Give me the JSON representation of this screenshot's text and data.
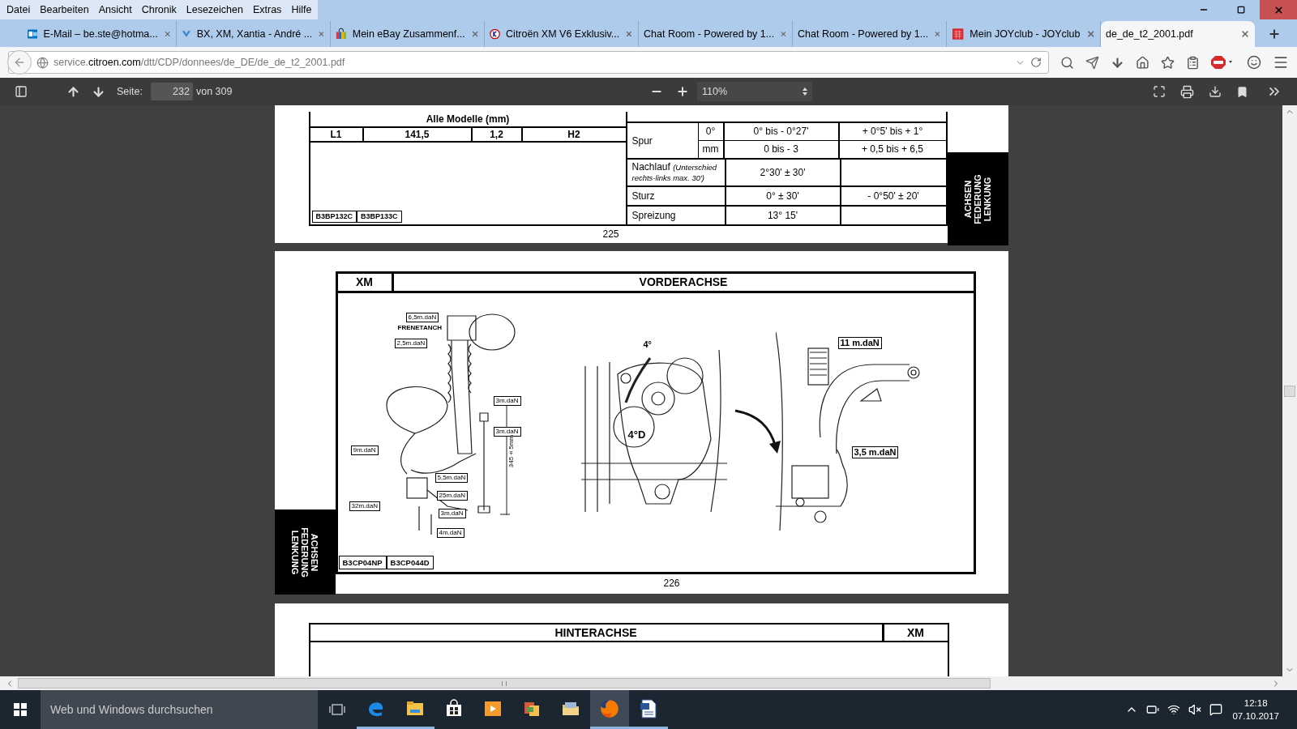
{
  "menu": [
    "Datei",
    "Bearbeiten",
    "Ansicht",
    "Chronik",
    "Lesezeichen",
    "Extras",
    "Hilfe"
  ],
  "tabs": [
    {
      "title": "E-Mail – be.ste@hotma...",
      "kind": "mail",
      "selected": false
    },
    {
      "title": "BX, XM, Xantia - André ...",
      "kind": "chevron",
      "selected": false
    },
    {
      "title": "Mein eBay Zusammenf...",
      "kind": "bag",
      "selected": false
    },
    {
      "title": "Citroën XM V6 Exklusiv...",
      "kind": "circle",
      "selected": false
    },
    {
      "title": "Chat Room - Powered by 1...",
      "kind": "plain",
      "selected": false
    },
    {
      "title": "Chat Room - Powered by 1...",
      "kind": "plain",
      "selected": false
    },
    {
      "title": "Mein JOYclub - JOYclub",
      "kind": "calendar",
      "selected": false
    },
    {
      "title": "de_de_t2_2001.pdf",
      "kind": "plain",
      "selected": true
    }
  ],
  "address": "service.**citroen.com**/dtt/CDP/donnees/de_DE/de_de_t2_2001.pdf",
  "pdf_toolbar": {
    "page_label": "Seite:",
    "page": "232",
    "page_count": "von 309",
    "zoom": "110%"
  },
  "page_225": {
    "left_table": {
      "header": "Alle Modelle (mm)",
      "cells": [
        "L1",
        "141,5",
        "1,2",
        "H2"
      ],
      "refs": [
        "B3BP132C",
        "B3BP133C"
      ]
    },
    "right_table": [
      {
        "label": "Spur",
        "sub_rows": [
          {
            "unit": "0°",
            "values": [
              "0° bis - 0°27'",
              "+ 0°5' bis + 1°"
            ]
          },
          {
            "unit": "mm",
            "values": [
              "0 bis - 3",
              "+ 0,5 bis + 6,5"
            ]
          }
        ]
      },
      {
        "label": "Nachlauf *(Unterschied rechts-links max. 30')*",
        "values": [
          "2°30' ± 30'"
        ]
      },
      {
        "label": "Sturz",
        "values": [
          "0° ± 30'",
          "- 0°50' ± 20'"
        ]
      },
      {
        "label": "Spreizung",
        "values": [
          "13° 15'"
        ]
      }
    ],
    "side_tab": [
      "ACHSEN",
      "FEDERUNG",
      "LENKUNG"
    ],
    "page_number": "225"
  },
  "page_226": {
    "model": "XM",
    "title": "VORDERACHSE",
    "drawings": [
      {
        "kind": "strut",
        "callouts": [
          "6,5m.daN",
          "FRENETANCH",
          "2,5m.daN",
          "3m.daN",
          "3m.daN",
          "9m.daN",
          "5,5m.daN",
          "25m.daN",
          "32m.daN",
          "3m.daN",
          "4m.daN",
          "345±5mm"
        ]
      },
      {
        "kind": "hub",
        "callouts": [
          "4°",
          "4°D"
        ]
      },
      {
        "kind": "wishbone",
        "callouts": [
          "11 m.daN",
          "3,5 m.daN"
        ]
      }
    ],
    "refs": [
      "B3CP04NP",
      "B3CP044D"
    ],
    "side_tab": [
      "ACHSEN",
      "FEDERUNG",
      "LENKUNG"
    ],
    "page_number": "226"
  },
  "page_227": {
    "title": "HINTERACHSE",
    "model": "XM"
  },
  "taskbar": {
    "search_placeholder": "Web und Windows durchsuchen",
    "apps": [
      {
        "kind": "edge",
        "selected": false
      },
      {
        "kind": "explorer",
        "selected": false
      },
      {
        "kind": "store",
        "selected": false
      },
      {
        "kind": "media",
        "selected": false
      },
      {
        "kind": "office",
        "selected": false
      },
      {
        "kind": "folder",
        "selected": false
      },
      {
        "kind": "firefox",
        "selected": true
      },
      {
        "kind": "document",
        "selected": false
      }
    ],
    "time": "12:18",
    "date": "07.10.2017"
  }
}
